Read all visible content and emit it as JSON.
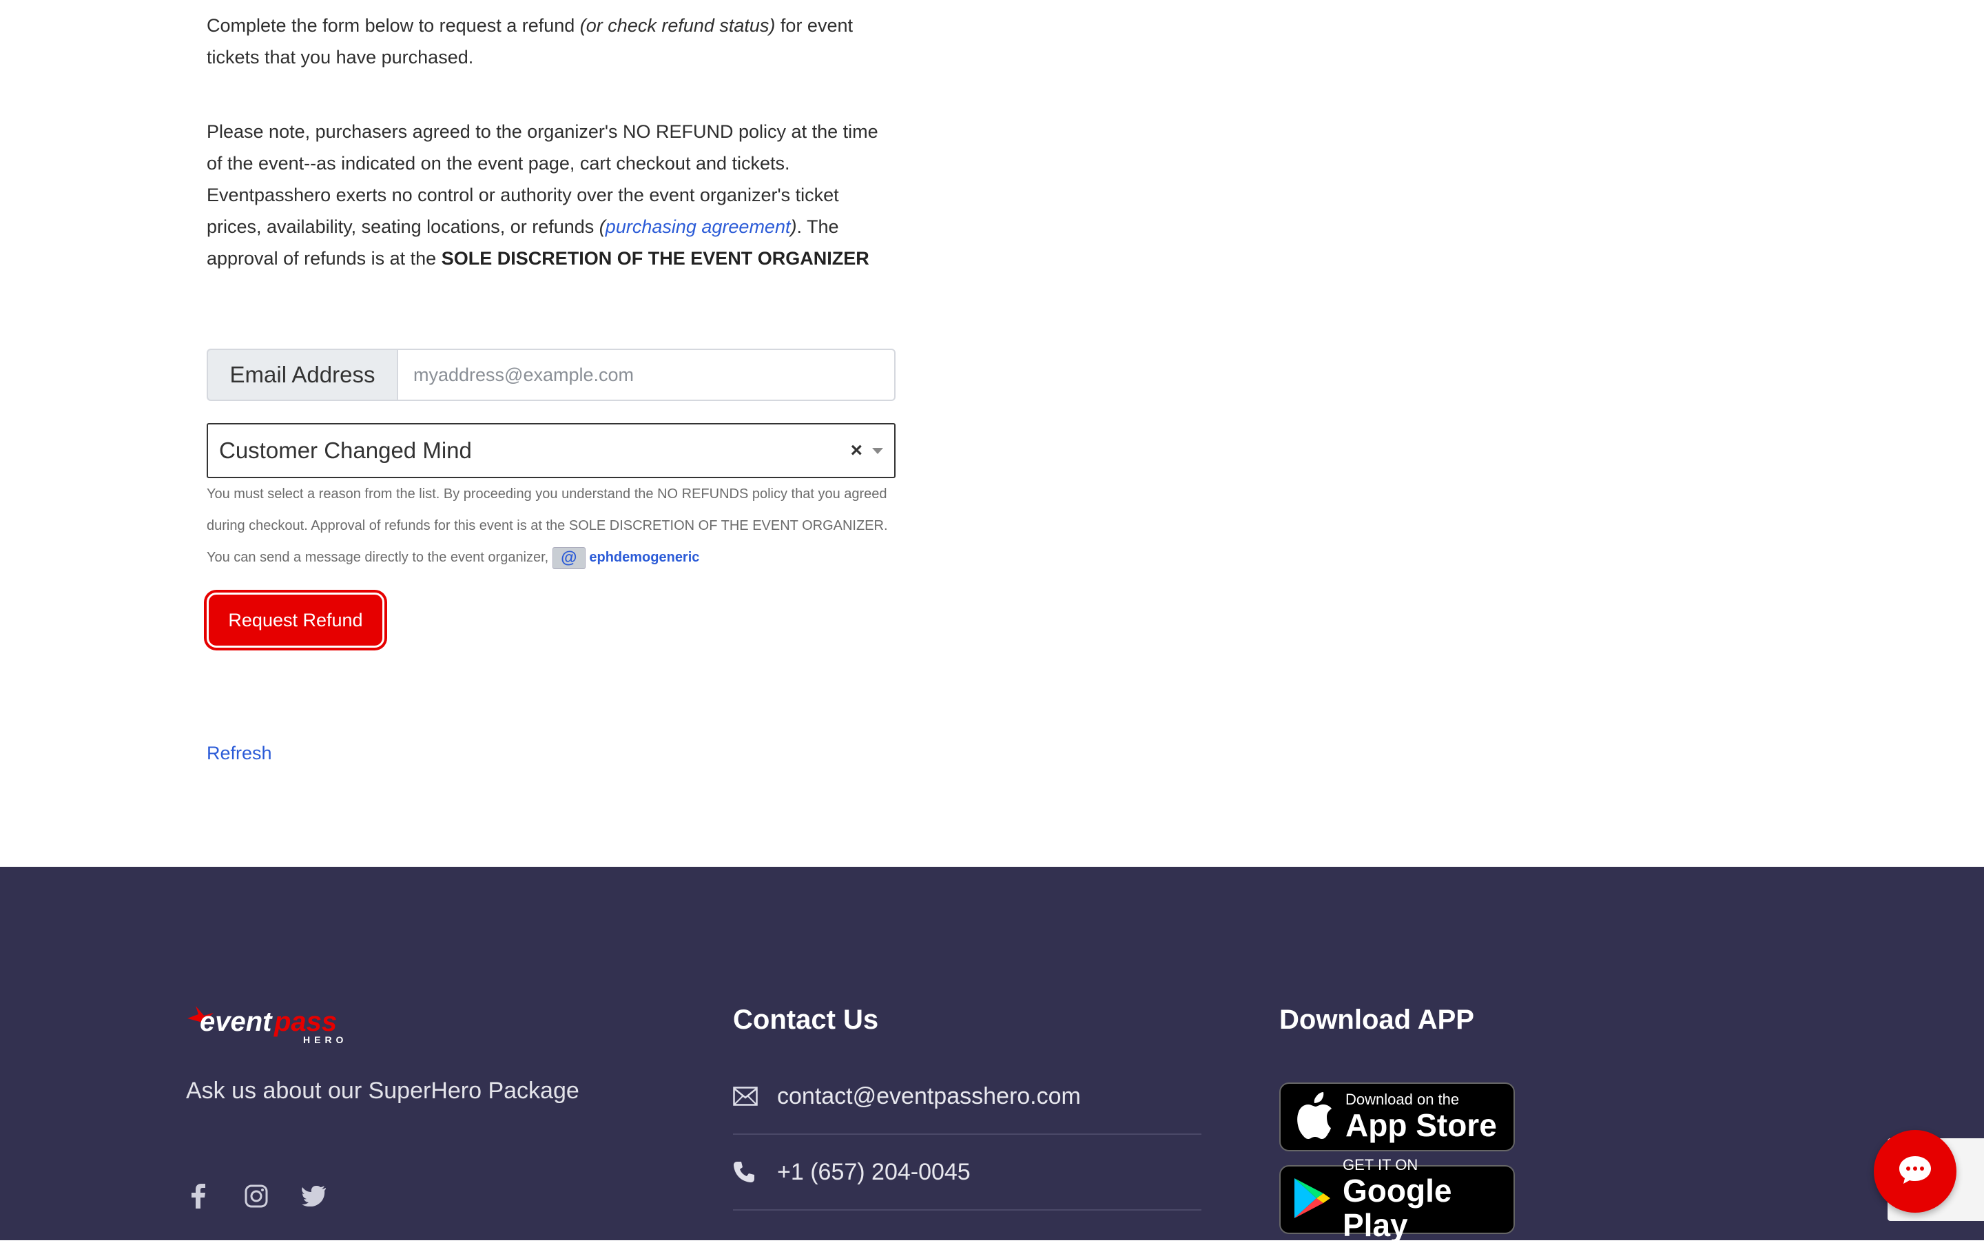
{
  "intro": {
    "text_before": "Complete the form below to request a refund ",
    "text_italic": "(or check refund status)",
    "text_after": " for event tickets that you have purchased."
  },
  "policy": {
    "text_before": "Please note, purchasers agreed to the organizer's NO REFUND policy at the time of the event--as indicated on the event page, cart checkout and tickets. Eventpasshero exerts no control or authority over the event organizer's ticket prices, availability, seating locations, or refunds ",
    "link_open": "(",
    "link_label": "purchasing agreement",
    "link_close": ")",
    "text_middle": ". The approval of refunds is at the ",
    "text_bold": "SOLE DISCRETION OF THE EVENT ORGANIZER"
  },
  "form": {
    "email_label": "Email Address",
    "email_placeholder": "myaddress@example.com",
    "email_value": "",
    "reason_value": "Customer Changed Mind",
    "clear_symbol": "×",
    "help_text": "You must select a reason from the list. By proceeding you understand the NO REFUNDS policy that you agreed during checkout. Approval of refunds for this event is at the SOLE DISCRETION OF THE EVENT ORGANIZER. You can send a message directly to the event organizer, ",
    "at_symbol": "@",
    "organizer_handle": "ephdemogeneric",
    "submit_label": "Request Refund",
    "refresh_label": "Refresh"
  },
  "footer": {
    "tagline": "Ask us about our SuperHero Package",
    "logo": {
      "word1": "event",
      "word2": "pass",
      "word3": "HERO"
    },
    "social_icons": [
      "facebook-icon",
      "instagram-icon",
      "twitter-icon"
    ],
    "contact": {
      "title": "Contact Us",
      "email": "contact@eventpasshero.com",
      "phone": "+1 (657) 204-0045"
    },
    "download": {
      "title": "Download APP",
      "app_store_small": "Download on the",
      "app_store_big": "App Store",
      "google_play_small": "GET IT ON",
      "google_play_big": "Google Play"
    }
  },
  "colors": {
    "accent_red": "#e60000",
    "link_blue": "#2b5bd7",
    "footer_bg": "#333150"
  }
}
